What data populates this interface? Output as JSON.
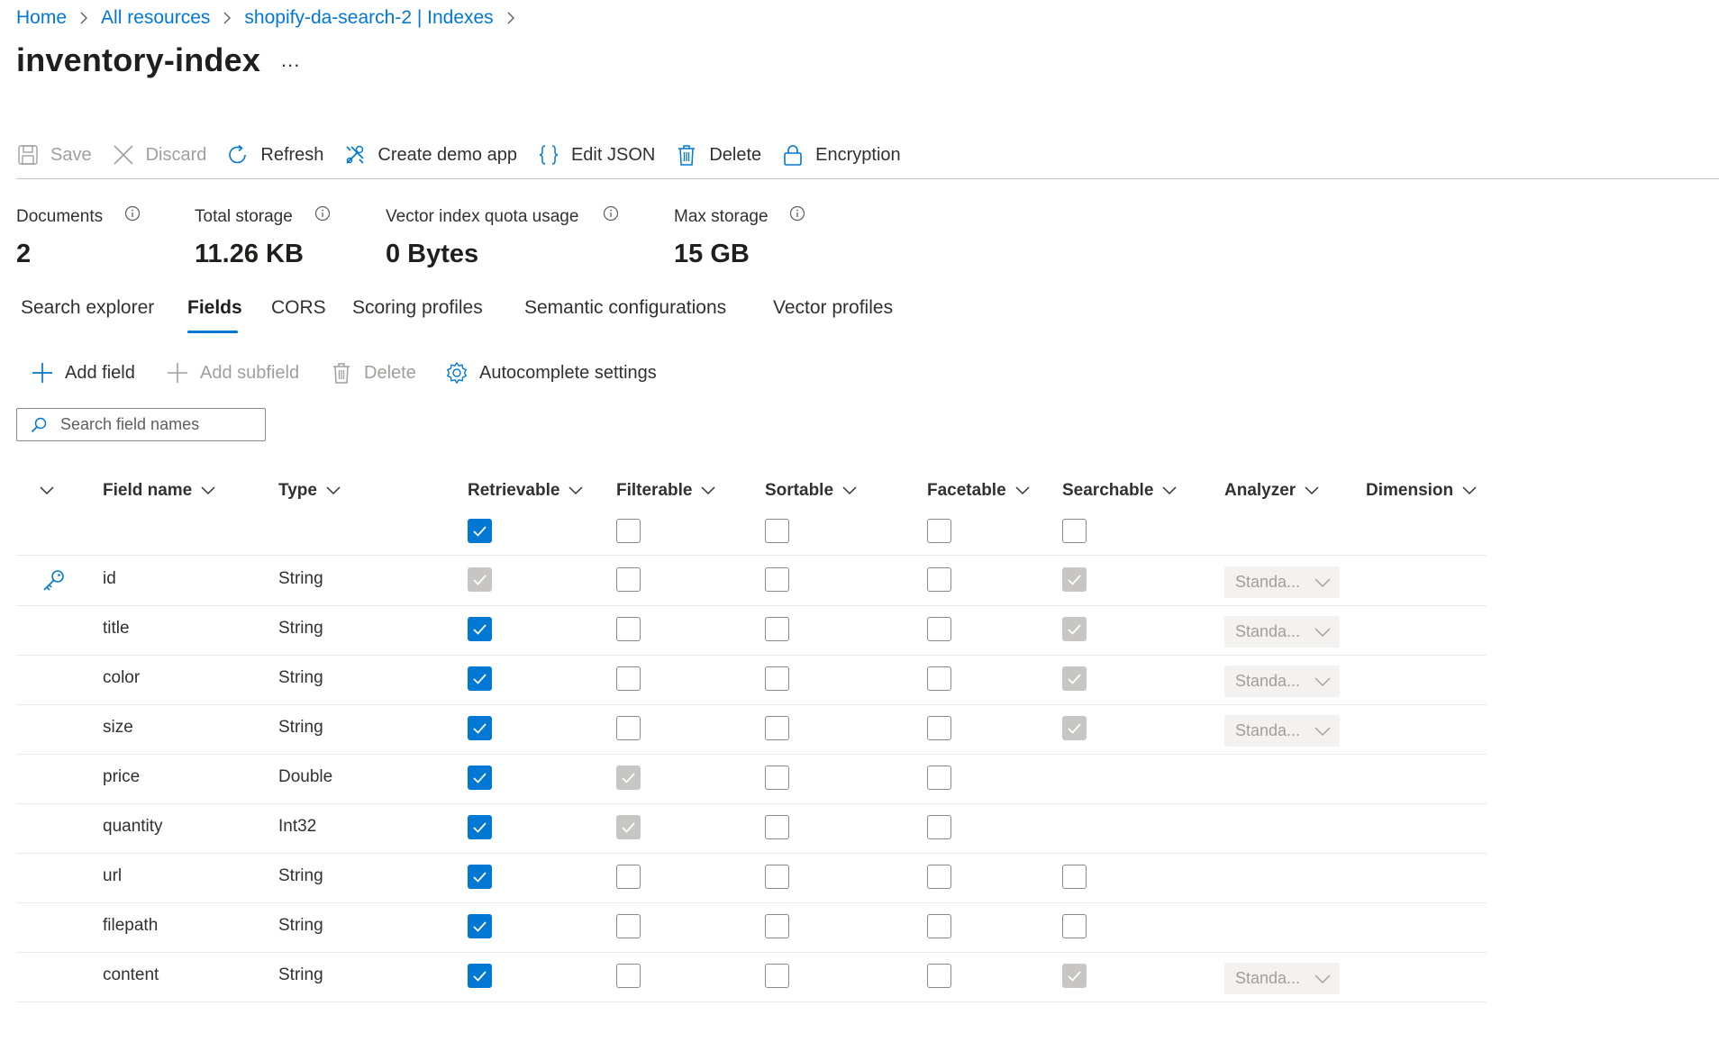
{
  "breadcrumb": [
    "Home",
    "All resources",
    "shopify-da-search-2 | Indexes"
  ],
  "title": "inventory-index",
  "more_label": "...",
  "toolbar": {
    "save": "Save",
    "discard": "Discard",
    "refresh": "Refresh",
    "create_demo_app": "Create demo app",
    "edit_json": "Edit JSON",
    "delete": "Delete",
    "encryption": "Encryption"
  },
  "stats": {
    "documents": {
      "label": "Documents",
      "value": "2"
    },
    "total_storage": {
      "label": "Total storage",
      "value": "11.26 KB"
    },
    "vector_quota": {
      "label": "Vector index quota usage",
      "value": "0 Bytes"
    },
    "max_storage": {
      "label": "Max storage",
      "value": "15 GB"
    }
  },
  "tabs": [
    "Search explorer",
    "Fields",
    "CORS",
    "Scoring profiles",
    "Semantic configurations",
    "Vector profiles"
  ],
  "active_tab": "Fields",
  "commands": {
    "add_field": "Add field",
    "add_subfield": "Add subfield",
    "delete": "Delete",
    "autocomplete": "Autocomplete settings"
  },
  "search": {
    "placeholder": "Search field names",
    "value": ""
  },
  "columns": {
    "field_name": "Field name",
    "type": "Type",
    "retrievable": "Retrievable",
    "filterable": "Filterable",
    "sortable": "Sortable",
    "facetable": "Facetable",
    "searchable": "Searchable",
    "analyzer": "Analyzer",
    "dimension": "Dimension"
  },
  "select_all": {
    "retrievable": true,
    "filterable": false,
    "sortable": false,
    "facetable": false,
    "searchable": false
  },
  "rows": [
    {
      "name": "id",
      "type": "String",
      "key": true,
      "retrievable": "checked-disabled",
      "filterable": "unchecked",
      "sortable": "unchecked",
      "facetable": "unchecked",
      "searchable": "checked-disabled",
      "analyzer": "Standa..."
    },
    {
      "name": "title",
      "type": "String",
      "key": false,
      "retrievable": "checked",
      "filterable": "unchecked",
      "sortable": "unchecked",
      "facetable": "unchecked",
      "searchable": "checked-disabled",
      "analyzer": "Standa..."
    },
    {
      "name": "color",
      "type": "String",
      "key": false,
      "retrievable": "checked",
      "filterable": "unchecked",
      "sortable": "unchecked",
      "facetable": "unchecked",
      "searchable": "checked-disabled",
      "analyzer": "Standa..."
    },
    {
      "name": "size",
      "type": "String",
      "key": false,
      "retrievable": "checked",
      "filterable": "unchecked",
      "sortable": "unchecked",
      "facetable": "unchecked",
      "searchable": "checked-disabled",
      "analyzer": "Standa..."
    },
    {
      "name": "price",
      "type": "Double",
      "key": false,
      "retrievable": "checked",
      "filterable": "checked-disabled",
      "sortable": "unchecked",
      "facetable": "unchecked",
      "searchable": "none",
      "analyzer": ""
    },
    {
      "name": "quantity",
      "type": "Int32",
      "key": false,
      "retrievable": "checked",
      "filterable": "checked-disabled",
      "sortable": "unchecked",
      "facetable": "unchecked",
      "searchable": "none",
      "analyzer": ""
    },
    {
      "name": "url",
      "type": "String",
      "key": false,
      "retrievable": "checked",
      "filterable": "unchecked",
      "sortable": "unchecked",
      "facetable": "unchecked",
      "searchable": "unchecked",
      "analyzer": ""
    },
    {
      "name": "filepath",
      "type": "String",
      "key": false,
      "retrievable": "checked",
      "filterable": "unchecked",
      "sortable": "unchecked",
      "facetable": "unchecked",
      "searchable": "unchecked",
      "analyzer": ""
    },
    {
      "name": "content",
      "type": "String",
      "key": false,
      "retrievable": "checked",
      "filterable": "unchecked",
      "sortable": "unchecked",
      "facetable": "unchecked",
      "searchable": "checked-disabled",
      "analyzer": "Standa..."
    }
  ],
  "colors": {
    "accent": "#0078d4",
    "disabled": "#a19f9d",
    "text": "#323130"
  }
}
